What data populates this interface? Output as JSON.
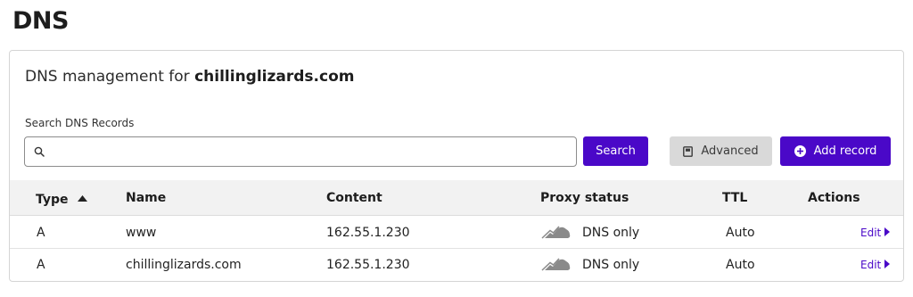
{
  "page": {
    "title": "DNS"
  },
  "card": {
    "heading_prefix": "DNS management for",
    "domain": "chillinglizards.com"
  },
  "search": {
    "label": "Search DNS Records",
    "value": "",
    "placeholder": ""
  },
  "buttons": {
    "search": "Search",
    "advanced": "Advanced",
    "add_record": "Add record"
  },
  "table": {
    "columns": {
      "type": "Type",
      "name": "Name",
      "content": "Content",
      "proxy_status": "Proxy status",
      "ttl": "TTL",
      "actions": "Actions"
    },
    "sort": {
      "column": "type",
      "direction": "ascending"
    },
    "rows": [
      {
        "type": "A",
        "name": "www",
        "content": "162.55.1.230",
        "proxy_status": "DNS only",
        "ttl": "Auto",
        "action": "Edit"
      },
      {
        "type": "A",
        "name": "chillinglizards.com",
        "content": "162.55.1.230",
        "proxy_status": "DNS only",
        "ttl": "Auto",
        "action": "Edit"
      }
    ]
  },
  "colors": {
    "primary": "#4a08c8",
    "secondary_button": "#d9d9d9",
    "table_header_bg": "#f2f2f2",
    "cloud_icon": "#8a8a8a"
  },
  "icons": {
    "search_field": "search-icon",
    "advanced": "bookmark-icon",
    "add_record": "plus-circle-icon",
    "sort": "caret-up-icon",
    "proxy_status": "cloud-icon",
    "edit": "caret-right-icon"
  }
}
